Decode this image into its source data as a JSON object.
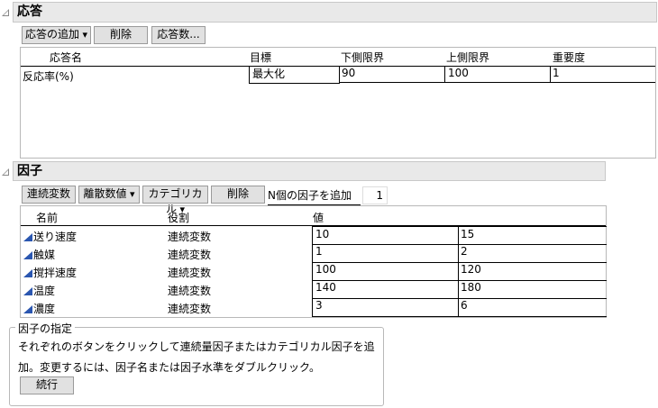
{
  "responses": {
    "title": "応答",
    "buttons": {
      "add": "応答の追加",
      "delete": "削除",
      "count": "応答数..."
    },
    "columns": [
      "応答名",
      "目標",
      "下側限界",
      "上側限界",
      "重要度"
    ],
    "rows": [
      {
        "name": "反応率(%)",
        "goal": "最大化",
        "lower": "90",
        "upper": "100",
        "importance": "1"
      }
    ]
  },
  "factors": {
    "title": "因子",
    "buttons": {
      "continuous": "連続変数",
      "discrete": "離散数値",
      "categorical": "カテゴリカル",
      "delete": "削除"
    },
    "add_n_label": "N個の因子を追加",
    "add_n_value": "1",
    "columns": [
      "名前",
      "役割",
      "値"
    ],
    "rows": [
      {
        "name": "送り速度",
        "role": "連続変数",
        "low": "10",
        "high": "15"
      },
      {
        "name": "触媒",
        "role": "連続変数",
        "low": "1",
        "high": "2"
      },
      {
        "name": "撹拌速度",
        "role": "連続変数",
        "low": "100",
        "high": "120"
      },
      {
        "name": "温度",
        "role": "連続変数",
        "low": "140",
        "high": "180"
      },
      {
        "name": "濃度",
        "role": "連続変数",
        "low": "3",
        "high": "6"
      }
    ]
  },
  "spec": {
    "title": "因子の指定",
    "text1": "それぞれのボタンをクリックして連続量因子またはカテゴリカル因子を追",
    "text2": "加。変更するには、因子名または因子水準をダブルクリック。",
    "continue": "続行"
  }
}
